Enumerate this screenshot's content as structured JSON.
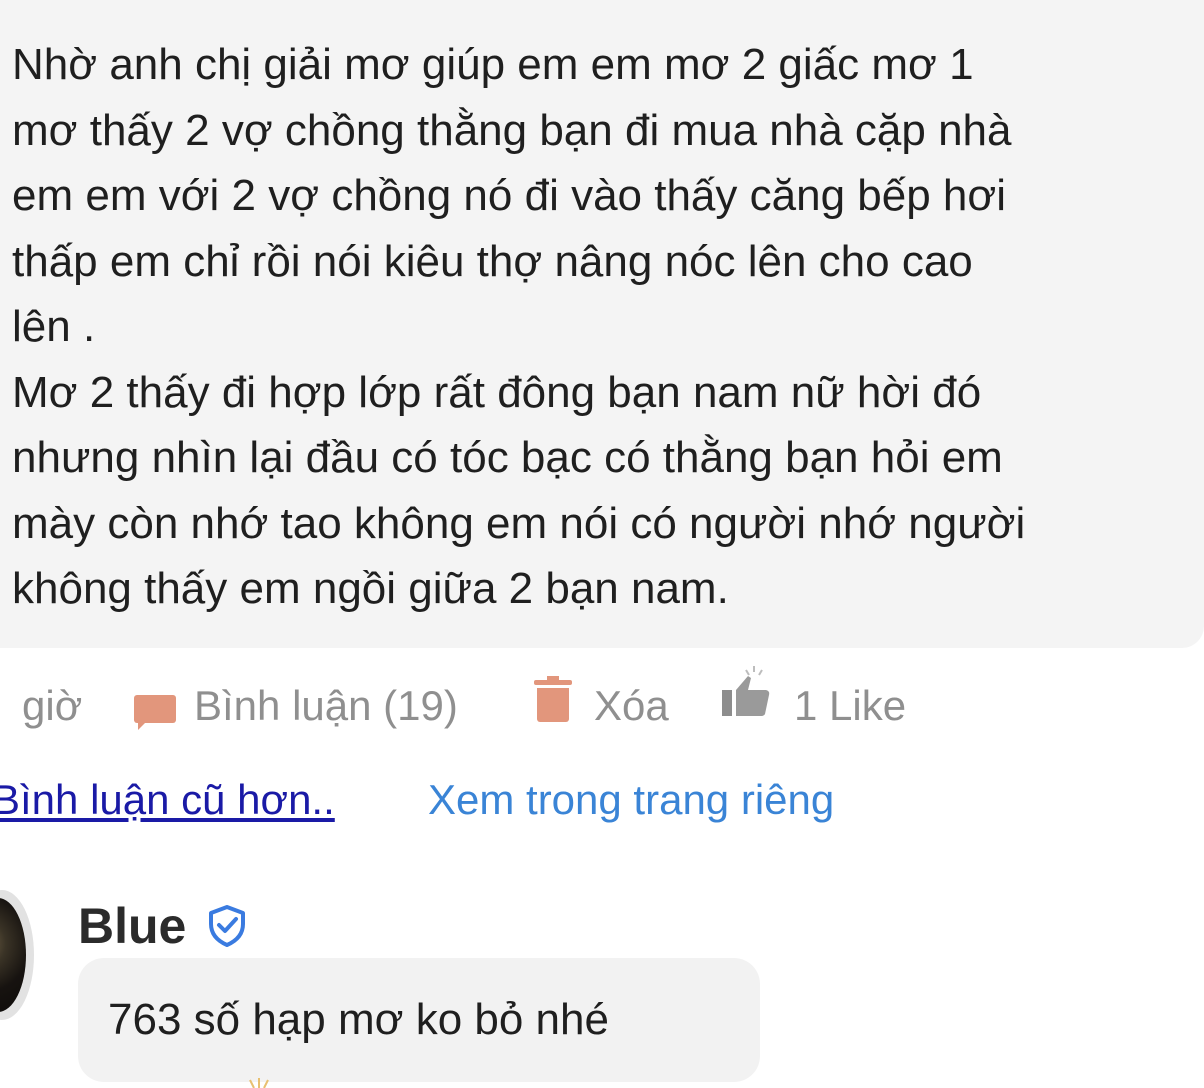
{
  "post": {
    "text": "Nhờ anh chị giải mơ giúp em em mơ 2 giấc mơ 1\nmơ thấy 2 vợ chồng thằng bạn đi mua nhà cặp nhà\nem em với 2 vợ chồng nó đi vào thấy căng bếp hơi\nthấp em chỉ rồi nói kiêu thợ nâng nóc lên cho cao\nlên .\nMơ 2 thấy đi hợp lớp rất đông bạn nam nữ hời đó\nnhưng nhìn lại đầu có tóc bạc có thằng bạn hỏi em\nmày còn nhớ tao không em nói có người nhớ người\nkhông thấy em ngồi giữa 2 bạn nam."
  },
  "actions": {
    "time_text": "giờ",
    "comment_label": "Bình luận (19)",
    "comment_icon": "comment-icon",
    "delete_label": "Xóa",
    "delete_icon": "trash-icon",
    "like_label": "1 Like",
    "like_icon": "thumbs-up-icon",
    "icon_color": "#e2967c"
  },
  "links": {
    "older_comments": "Bình luận cũ hơn..",
    "view_separately": "Xem trong trang riêng"
  },
  "reply": {
    "username": "Blue",
    "verified_icon": "verified-shield-icon",
    "text": "763 số hạp mơ ko bỏ nhé"
  }
}
